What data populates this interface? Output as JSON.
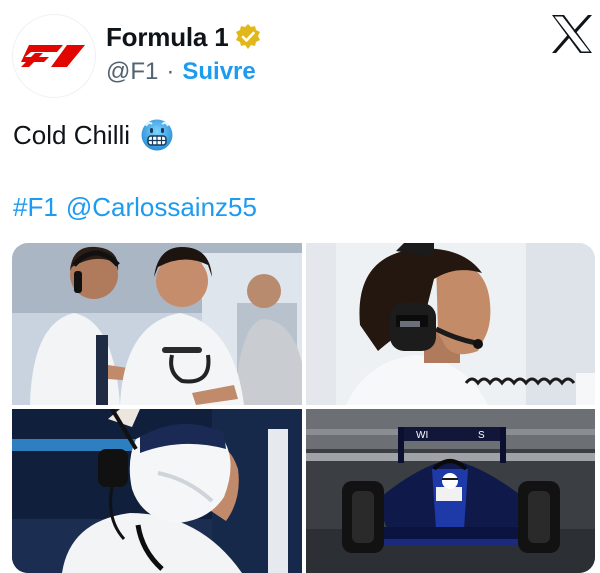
{
  "account": {
    "display_name": "Formula 1",
    "handle": "@F1",
    "separator": "·",
    "follow_label": "Suivre",
    "avatar_logo": "f1-logo",
    "verified_badge": "gold-verified-icon"
  },
  "platform": {
    "logo": "x-logo-icon"
  },
  "tweet": {
    "text": "Cold Chilli",
    "emoji": "cold-face-emoji",
    "hashtag": "#F1",
    "mention": "@Carlossainz55"
  },
  "colors": {
    "link": "#1d9bf0",
    "text": "#0f1419",
    "muted": "#536471",
    "f1_red": "#e10600",
    "verified_gold": "#e2b719"
  },
  "media": {
    "photos": [
      {
        "name": "photo-pit-conversation"
      },
      {
        "name": "photo-headset-profile"
      },
      {
        "name": "photo-helmet-on"
      },
      {
        "name": "photo-car-on-track"
      }
    ],
    "car_badge": "WILLIAMS"
  }
}
